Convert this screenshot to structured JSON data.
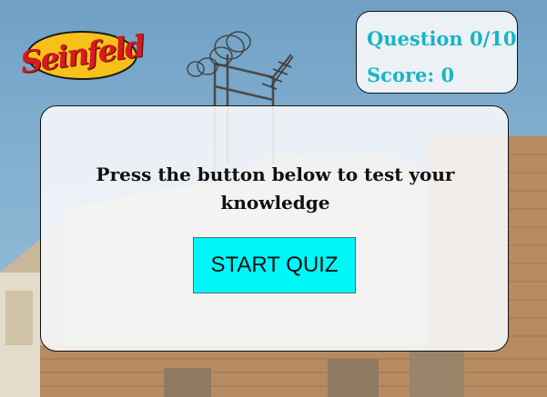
{
  "brand": {
    "logo_text": "Seinfeld",
    "logo_colors": {
      "text": "#d71920",
      "oval": "#f6c21a"
    }
  },
  "scoreboard": {
    "question_label": "Question 0/10",
    "score_label": "Score: 0",
    "text_color": "#19b5c3"
  },
  "quiz": {
    "prompt": "Press the button below to test your knowledge",
    "start_button_label": "START QUIZ",
    "button_color": "#00f7f7"
  }
}
